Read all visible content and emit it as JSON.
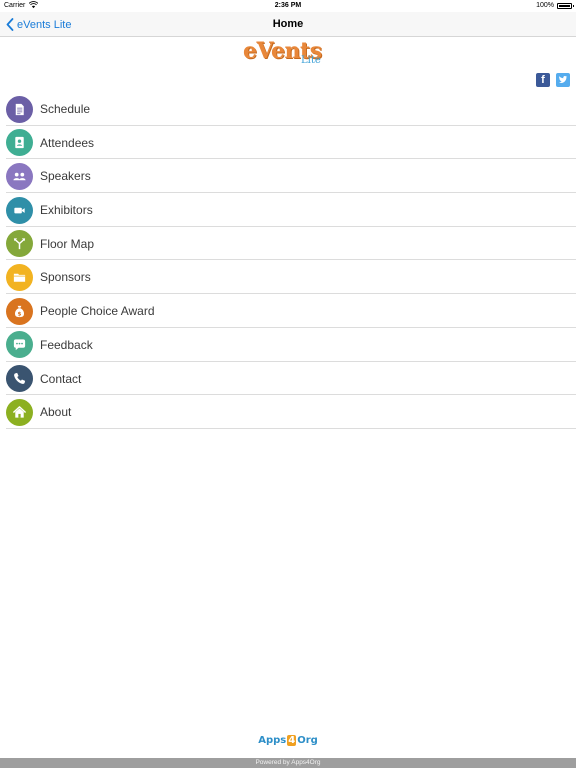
{
  "status_bar": {
    "carrier": "Carrier",
    "time": "2:36 PM",
    "battery": "100%"
  },
  "nav": {
    "back_label": "eVents Lite",
    "title": "Home"
  },
  "logo": {
    "main": "eVents",
    "sub": "Lite"
  },
  "social": {
    "facebook": "f",
    "twitter": "t"
  },
  "menu": {
    "items": [
      {
        "label": "Schedule",
        "icon": "document-icon",
        "color": "#6b5fa6"
      },
      {
        "label": "Attendees",
        "icon": "contact-card-icon",
        "color": "#3fae93"
      },
      {
        "label": "Speakers",
        "icon": "people-icon",
        "color": "#8a77c0"
      },
      {
        "label": "Exhibitors",
        "icon": "video-camera-icon",
        "color": "#2f8fa8"
      },
      {
        "label": "Floor Map",
        "icon": "directions-icon",
        "color": "#84a83a"
      },
      {
        "label": "Sponsors",
        "icon": "folder-icon",
        "color": "#f2b321"
      },
      {
        "label": "People Choice Award",
        "icon": "money-bag-icon",
        "color": "#d9741f"
      },
      {
        "label": "Feedback",
        "icon": "chat-bubble-icon",
        "color": "#4aae8e"
      },
      {
        "label": "Contact",
        "icon": "phone-icon",
        "color": "#3a5470"
      },
      {
        "label": "About",
        "icon": "home-icon",
        "color": "#8cb021"
      }
    ]
  },
  "footer": {
    "logo_prefix": "Apps",
    "logo_four": "4",
    "logo_suffix": "Org",
    "powered_by": "Powered by Apps4Org"
  }
}
